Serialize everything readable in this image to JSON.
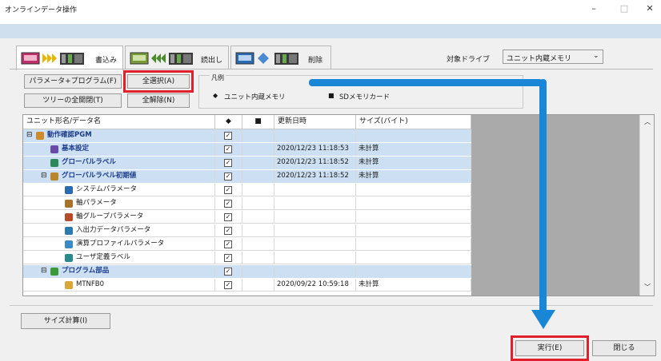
{
  "window": {
    "title": "オンラインデータ操作",
    "minimize": "–",
    "maximize": "□",
    "close": "✕"
  },
  "tabs": [
    {
      "label": "書込み",
      "active": true
    },
    {
      "label": "読出し",
      "active": false
    },
    {
      "label": "削除",
      "active": false
    }
  ],
  "drive": {
    "label": "対象ドライブ",
    "value": "ユニット内蔵メモリ"
  },
  "buttons": {
    "param_program": "パラメータ+プログラム(F)",
    "select_all": "全選択(A)",
    "tree_expand": "ツリーの全開閉(T)",
    "deselect_all": "全解除(N)",
    "size_calc": "サイズ計算(I)",
    "execute": "実行(E)",
    "close": "閉じる"
  },
  "legend": {
    "title": "凡例",
    "item1": "ユニット内蔵メモリ",
    "item2": "SDメモリカード"
  },
  "columns": {
    "name": "ユニット形名/データ名",
    "col_mem": "◆",
    "col_sd": "■",
    "date": "更新日時",
    "size": "サイズ(バイト)"
  },
  "rows": [
    {
      "name": "動作確認PGM",
      "level": 0,
      "expander": "⊟",
      "bold": true,
      "sel": true,
      "checked": true,
      "date": "",
      "size": ""
    },
    {
      "name": "基本設定",
      "level": 1,
      "expander": "",
      "bold": true,
      "sel": true,
      "checked": true,
      "date": "2020/12/23 11:18:53",
      "size": "未計算"
    },
    {
      "name": "グローバルラベル",
      "level": 1,
      "expander": "",
      "bold": true,
      "sel": true,
      "checked": true,
      "date": "2020/12/23 11:18:52",
      "size": "未計算"
    },
    {
      "name": "グローバルラベル初期値",
      "level": 1,
      "expander": "⊟",
      "bold": true,
      "sel": true,
      "checked": true,
      "date": "2020/12/23 11:18:52",
      "size": "未計算"
    },
    {
      "name": "システムパラメータ",
      "level": 2,
      "expander": "",
      "bold": false,
      "sel": false,
      "checked": true,
      "date": "",
      "size": ""
    },
    {
      "name": "軸パラメータ",
      "level": 2,
      "expander": "",
      "bold": false,
      "sel": false,
      "checked": true,
      "date": "",
      "size": ""
    },
    {
      "name": "軸グループパラメータ",
      "level": 2,
      "expander": "",
      "bold": false,
      "sel": false,
      "checked": true,
      "date": "",
      "size": ""
    },
    {
      "name": "入出力データパラメータ",
      "level": 2,
      "expander": "",
      "bold": false,
      "sel": false,
      "checked": true,
      "date": "",
      "size": ""
    },
    {
      "name": "演算プロファイルパラメータ",
      "level": 2,
      "expander": "",
      "bold": false,
      "sel": false,
      "checked": true,
      "date": "",
      "size": ""
    },
    {
      "name": "ユーザ定義ラベル",
      "level": 2,
      "expander": "",
      "bold": false,
      "sel": false,
      "checked": true,
      "date": "",
      "size": ""
    },
    {
      "name": "プログラム部品",
      "level": 1,
      "expander": "⊟",
      "bold": true,
      "sel": true,
      "checked": true,
      "date": "",
      "size": ""
    },
    {
      "name": "MTNFB0",
      "level": 2,
      "expander": "",
      "bold": false,
      "sel": false,
      "checked": true,
      "date": "2020/09/22 10:59:18",
      "size": "未計算"
    }
  ],
  "colors": {
    "accent_arrow": "#1a86d6",
    "highlight_box": "#e0202c",
    "row_selected": "#cde0f3"
  }
}
